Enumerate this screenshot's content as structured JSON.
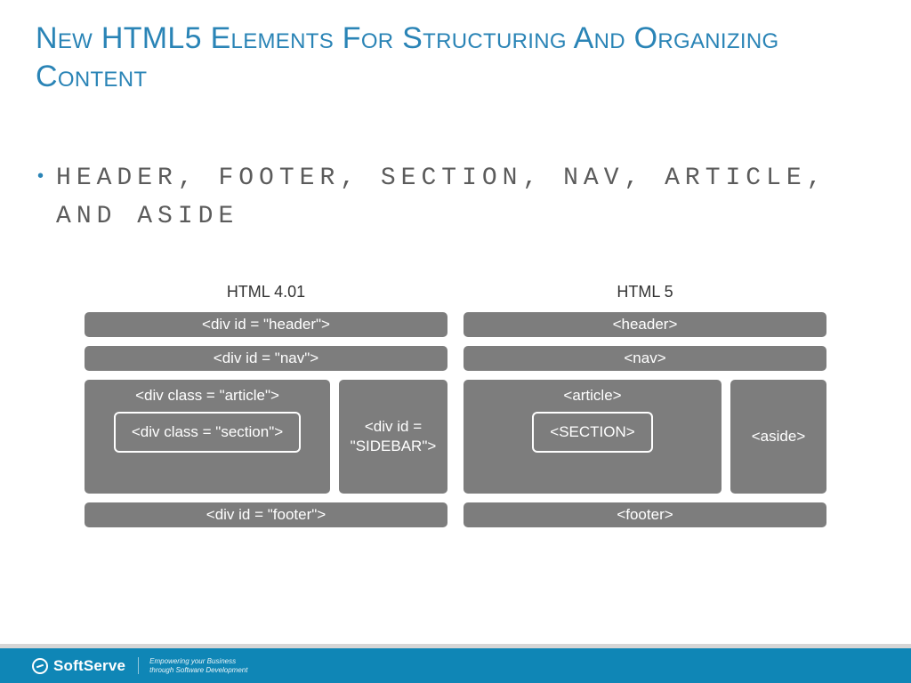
{
  "title": "New HTML5 Elements for Structuring and Organizing Content",
  "bullet": "HEADER, FOOTER, SECTION, NAV, ARTICLE, AND ASIDE",
  "diagram": {
    "left": {
      "title": "HTML 4.01",
      "header": "<div id = \"header\">",
      "nav": "<div id = \"nav\">",
      "article_label": "<div class = \"article\">",
      "section": "<div class = \"section\">",
      "sidebar": "<div id = \"SIDEBAR\">",
      "footer": "<div id = \"footer\">"
    },
    "right": {
      "title": "HTML 5",
      "header": "<header>",
      "nav": "<nav>",
      "article_label": "<article>",
      "section": "<SECTION>",
      "sidebar": "<aside>",
      "footer": "<footer>"
    }
  },
  "footer": {
    "brand": "SoftServe",
    "tagline1": "Empowering your Business",
    "tagline2": "through Software Development"
  }
}
